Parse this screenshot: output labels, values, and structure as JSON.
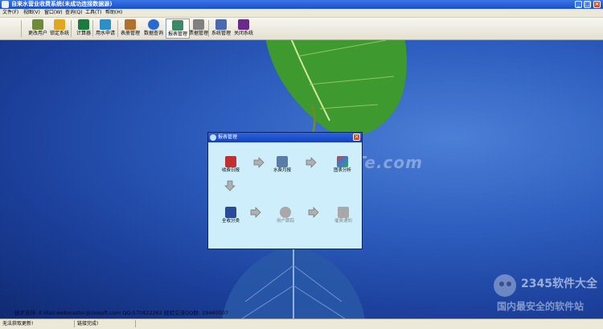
{
  "window": {
    "title": "自来水营业收费系统(未成功连接数据源)",
    "controls": {
      "minimize": "_",
      "maximize": "□",
      "close": "×"
    }
  },
  "menu": [
    "文件(F)",
    "视图(V)",
    "窗口(W)",
    "查询(Q)",
    "工具(T)",
    "帮助(H)"
  ],
  "toolbar": [
    {
      "label": "更改用户",
      "icon": "key-user-icon",
      "color": "#6f8a3a"
    },
    {
      "label": "锁定系统",
      "icon": "lock-icon",
      "color": "#e0a820"
    },
    {
      "label": "计算器",
      "icon": "calculator-icon",
      "color": "#1c7a3c"
    },
    {
      "label": "用水申请",
      "icon": "application-form-icon",
      "color": "#2e8ec8"
    },
    {
      "label": "表册管理",
      "icon": "book-manage-icon",
      "color": "#b07030"
    },
    {
      "label": "数据查询",
      "icon": "magnifier-icon",
      "color": "#2a6ad0"
    },
    {
      "label": "报表管理",
      "icon": "report-icon",
      "color": "#3a8a6a"
    },
    {
      "label": "票据管理",
      "icon": "receipt-icon",
      "color": "#808080"
    },
    {
      "label": "系统管理",
      "icon": "system-manage-icon",
      "color": "#4a6ab0"
    },
    {
      "label": "关闭系统",
      "icon": "exit-icon",
      "color": "#6a2a8a"
    }
  ],
  "dialog": {
    "title": "报表管理",
    "close": "×",
    "nodes": {
      "fee_log": {
        "label": "收费日报",
        "icon": "calendar-12-icon"
      },
      "water_month": {
        "label": "水费月报",
        "icon": "book-icon"
      },
      "chart_analysis": {
        "label": "图表分析",
        "icon": "chart-icon"
      },
      "full_collect": {
        "label": "全收分类",
        "icon": "binder-icon"
      },
      "user_tracking": {
        "label": "用户跟踪",
        "icon": "circle-icon"
      },
      "arrears_notice": {
        "label": "催费通知",
        "icon": "envelope-icon"
      }
    }
  },
  "watermark": "www.DuoTe.com",
  "brand": {
    "logo": "2345软件大全",
    "tagline": "国内最安全的软件站"
  },
  "support_text": "技术支持: E-Mail:webmaster@ziosoft.com QQ:570822262 经验交流QQ群: 19460007",
  "status": {
    "left": "无法获取更新!",
    "right": "链接完成!"
  },
  "colors": {
    "title_bar": "#1a4fc8",
    "desktop": "#2e5fc0",
    "dialog_bg": "#cdeefa",
    "leaf": "#3e9a2e"
  }
}
